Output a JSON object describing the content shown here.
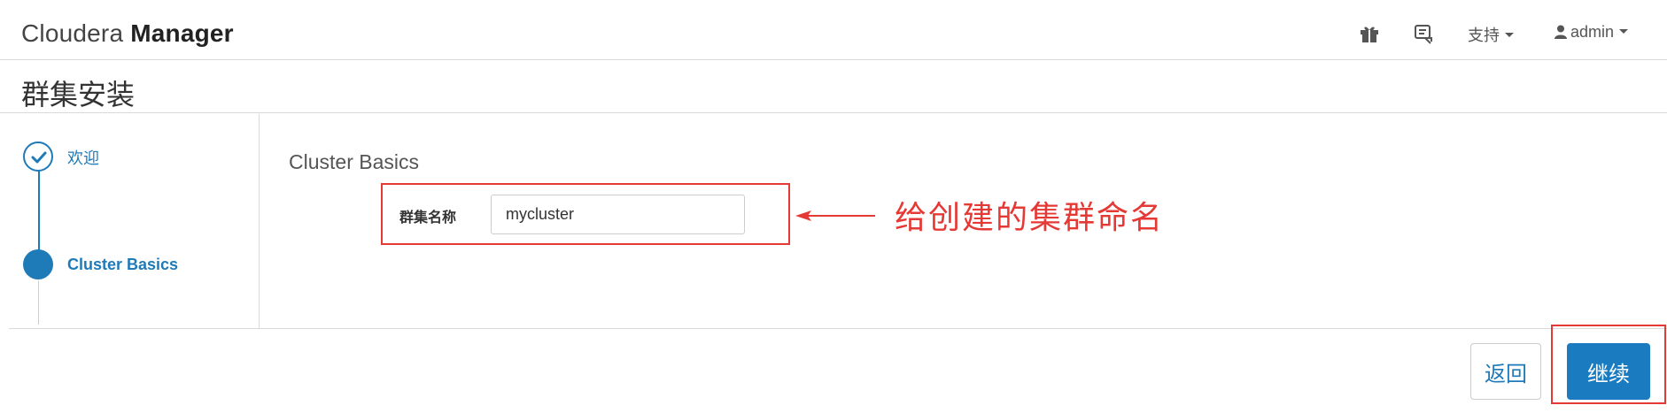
{
  "navbar": {
    "brand_light": "Cloudera",
    "brand_bold": "Manager",
    "support_label": "支持",
    "user_label": "admin",
    "icons": [
      "gift-icon",
      "feedback-icon",
      "user-icon"
    ]
  },
  "page": {
    "title": "群集安装"
  },
  "steps": [
    {
      "label": "欢迎",
      "state": "completed"
    },
    {
      "label": "Cluster Basics",
      "state": "current"
    }
  ],
  "main": {
    "section_title": "Cluster Basics",
    "cluster_name_label": "群集名称",
    "cluster_name_value": "mycluster"
  },
  "annotation": {
    "text": "给创建的集群命名",
    "color": "#e53935"
  },
  "footer": {
    "back_label": "返回",
    "continue_label": "继续"
  },
  "colors": {
    "accent": "#1f7ab8",
    "primary_button": "#1a7bc0",
    "annotation": "#e53935"
  }
}
